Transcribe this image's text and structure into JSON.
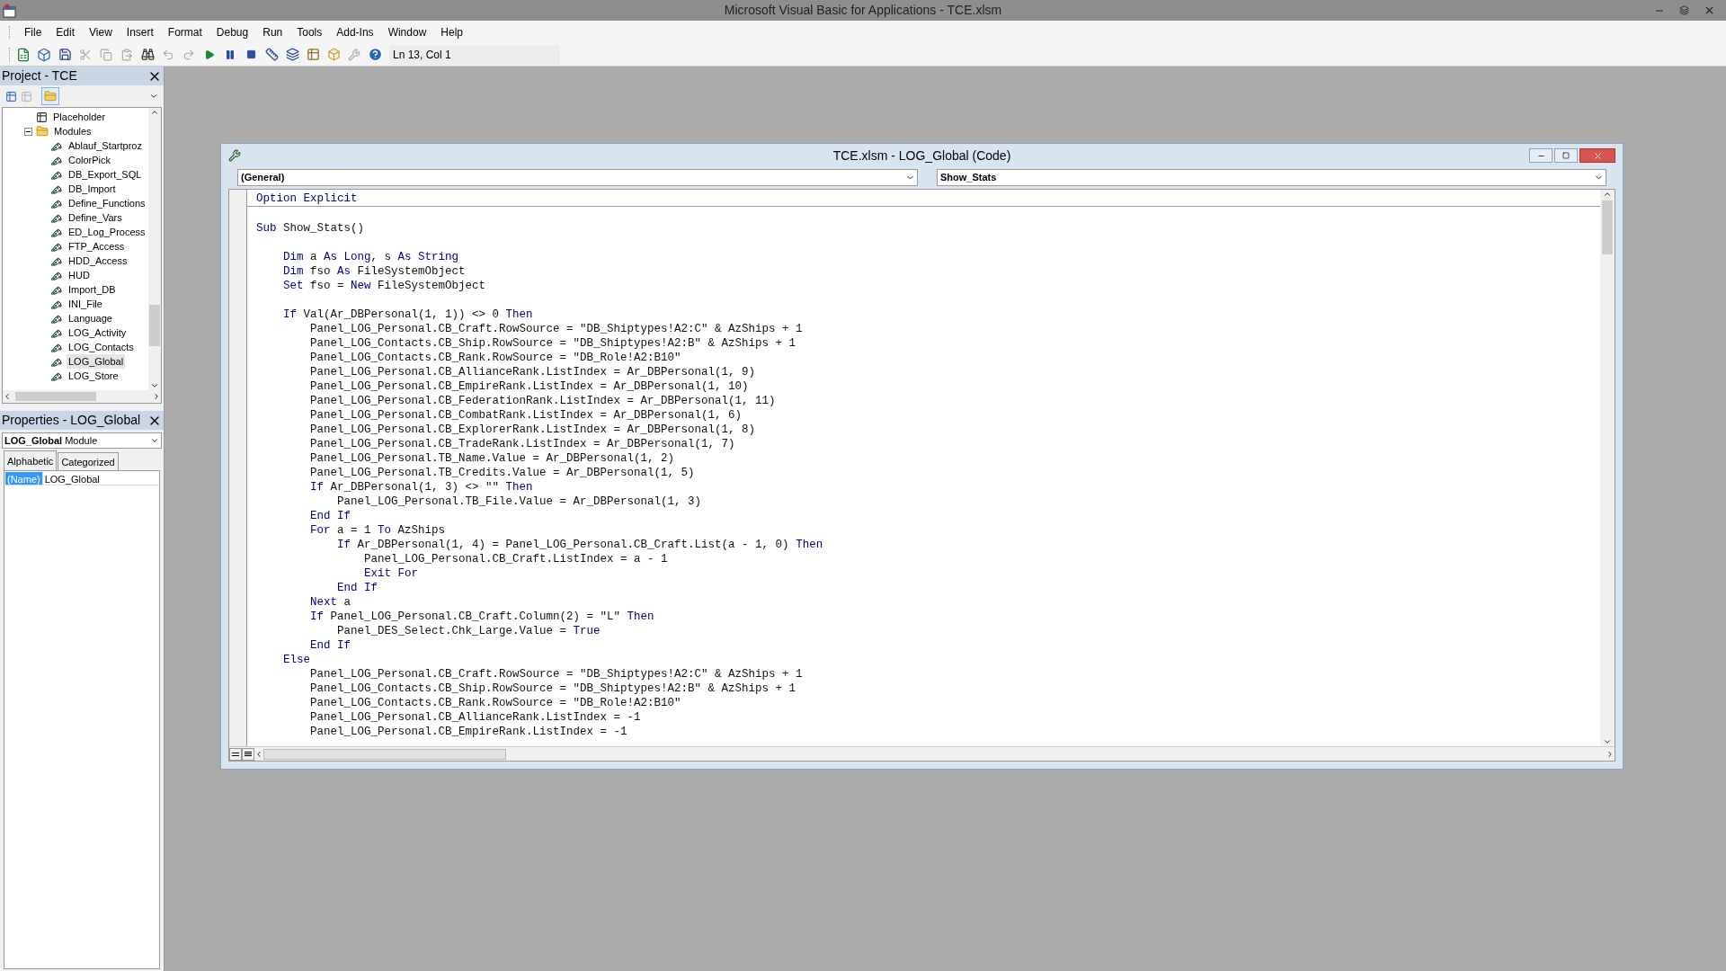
{
  "window": {
    "title": "Microsoft Visual Basic for Applications - TCE.xlsm"
  },
  "menu": [
    "File",
    "Edit",
    "View",
    "Insert",
    "Format",
    "Debug",
    "Run",
    "Tools",
    "Add-Ins",
    "Window",
    "Help"
  ],
  "toolbar": {
    "position": "Ln 13, Col 1"
  },
  "project": {
    "title": "Project - TCE",
    "tree": [
      {
        "label": "Placeholder",
        "kind": "form",
        "selected": false
      },
      {
        "label": "Modules",
        "kind": "folder",
        "expanded": true,
        "selected": false,
        "children": [
          {
            "label": "Ablauf_Startproz",
            "kind": "module",
            "selected": false
          },
          {
            "label": "ColorPick",
            "kind": "module",
            "selected": false
          },
          {
            "label": "DB_Export_SQL",
            "kind": "module",
            "selected": false
          },
          {
            "label": "DB_Import",
            "kind": "module",
            "selected": false
          },
          {
            "label": "Define_Functions",
            "kind": "module",
            "selected": false
          },
          {
            "label": "Define_Vars",
            "kind": "module",
            "selected": false
          },
          {
            "label": "ED_Log_Process",
            "kind": "module",
            "selected": false
          },
          {
            "label": "FTP_Access",
            "kind": "module",
            "selected": false
          },
          {
            "label": "HDD_Access",
            "kind": "module",
            "selected": false
          },
          {
            "label": "HUD",
            "kind": "module",
            "selected": false
          },
          {
            "label": "Import_DB",
            "kind": "module",
            "selected": false
          },
          {
            "label": "INI_File",
            "kind": "module",
            "selected": false
          },
          {
            "label": "Language",
            "kind": "module",
            "selected": false
          },
          {
            "label": "LOG_Activity",
            "kind": "module",
            "selected": false
          },
          {
            "label": "LOG_Contacts",
            "kind": "module",
            "selected": false
          },
          {
            "label": "LOG_Global",
            "kind": "module",
            "selected": true
          },
          {
            "label": "LOG_Store",
            "kind": "module",
            "selected": false
          }
        ]
      }
    ]
  },
  "properties": {
    "title": "Properties - LOG_Global",
    "object_name": "LOG_Global",
    "object_type": "Module",
    "tabs": [
      {
        "label": "Alphabetic",
        "selected": true
      },
      {
        "label": "Categorized",
        "selected": false
      }
    ],
    "rows": [
      {
        "name": "(Name)",
        "value": "LOG_Global",
        "selected": true
      }
    ]
  },
  "code_window": {
    "title": "TCE.xlsm - LOG_Global (Code)",
    "object": "(General)",
    "procedure": "Show_Stats",
    "lines": [
      [
        {
          "kind": "keyword",
          "text": "Option Explicit"
        }
      ],
      [
        {
          "kind": "blank_line"
        },
        {
          "kind": "keyword",
          "text": "Sub "
        },
        {
          "kind": "plain",
          "text": "Show_Stats()"
        }
      ],
      [
        {
          "kind": "blank_line"
        },
        {
          "kind": "keyword",
          "text": "    Dim "
        },
        {
          "kind": "plain",
          "text": "a "
        },
        {
          "kind": "keyword",
          "text": "As Long"
        },
        {
          "kind": "plain",
          "text": ", s "
        },
        {
          "kind": "keyword",
          "text": "As String"
        }
      ],
      [
        {
          "kind": "keyword",
          "text": "    Dim "
        },
        {
          "kind": "plain",
          "text": "fso "
        },
        {
          "kind": "keyword",
          "text": "As "
        },
        {
          "kind": "plain",
          "text": "FileSystemObject"
        }
      ],
      [
        {
          "kind": "keyword",
          "text": "    Set "
        },
        {
          "kind": "plain",
          "text": "fso = "
        },
        {
          "kind": "keyword",
          "text": "New "
        },
        {
          "kind": "plain",
          "text": "FileSystemObject"
        }
      ],
      [
        {
          "kind": "blank_line"
        },
        {
          "kind": "keyword",
          "text": "    If "
        },
        {
          "kind": "plain",
          "text": "Val(Ar_DBPersonal(1, 1)) <> 0 "
        },
        {
          "kind": "keyword",
          "text": "Then"
        }
      ],
      [
        {
          "kind": "plain",
          "text": "        Panel_LOG_Personal.CB_Craft.RowSource = \"DB_Shiptypes!A2:C\" & AzShips + 1"
        }
      ],
      [
        {
          "kind": "plain",
          "text": "        Panel_LOG_Contacts.CB_Ship.RowSource = \"DB_Shiptypes!A2:B\" & AzShips + 1"
        }
      ],
      [
        {
          "kind": "plain",
          "text": "        Panel_LOG_Contacts.CB_Rank.RowSource = \"DB_Role!A2:B10\""
        }
      ],
      [
        {
          "kind": "plain",
          "text": "        Panel_LOG_Personal.CB_AllianceRank.ListIndex = Ar_DBPersonal(1, 9)"
        }
      ],
      [
        {
          "kind": "plain",
          "text": "        Panel_LOG_Personal.CB_EmpireRank.ListIndex = Ar_DBPersonal(1, 10)"
        }
      ],
      [
        {
          "kind": "plain",
          "text": "        Panel_LOG_Personal.CB_FederationRank.ListIndex = Ar_DBPersonal(1, 11)"
        }
      ],
      [
        {
          "kind": "plain",
          "text": "        Panel_LOG_Personal.CB_CombatRank.ListIndex = Ar_DBPersonal(1, 6)"
        }
      ],
      [
        {
          "kind": "plain",
          "text": "        Panel_LOG_Personal.CB_ExplorerRank.ListIndex = Ar_DBPersonal(1, 8)"
        }
      ],
      [
        {
          "kind": "plain",
          "text": "        Panel_LOG_Personal.CB_TradeRank.ListIndex = Ar_DBPersonal(1, 7)"
        }
      ],
      [
        {
          "kind": "plain",
          "text": "        Panel_LOG_Personal.TB_Name.Value = Ar_DBPersonal(1, 2)"
        }
      ],
      [
        {
          "kind": "plain",
          "text": "        Panel_LOG_Personal.TB_Credits.Value = Ar_DBPersonal(1, 5)"
        }
      ],
      [
        {
          "kind": "keyword",
          "text": "        If "
        },
        {
          "kind": "plain",
          "text": "Ar_DBPersonal(1, 3) <> \"\" "
        },
        {
          "kind": "keyword",
          "text": "Then"
        }
      ],
      [
        {
          "kind": "plain",
          "text": "            Panel_LOG_Personal.TB_File.Value = Ar_DBPersonal(1, 3)"
        }
      ],
      [
        {
          "kind": "keyword",
          "text": "        End If"
        }
      ],
      [
        {
          "kind": "keyword",
          "text": "        For "
        },
        {
          "kind": "plain",
          "text": "a = 1 "
        },
        {
          "kind": "keyword",
          "text": "To "
        },
        {
          "kind": "plain",
          "text": "AzShips"
        }
      ],
      [
        {
          "kind": "keyword",
          "text": "            If "
        },
        {
          "kind": "plain",
          "text": "Ar_DBPersonal(1, 4) = Panel_LOG_Personal.CB_Craft.List(a - 1, 0) "
        },
        {
          "kind": "keyword",
          "text": "Then"
        }
      ],
      [
        {
          "kind": "plain",
          "text": "                Panel_LOG_Personal.CB_Craft.ListIndex = a - 1"
        }
      ],
      [
        {
          "kind": "keyword",
          "text": "                Exit For"
        }
      ],
      [
        {
          "kind": "keyword",
          "text": "            End If"
        }
      ],
      [
        {
          "kind": "keyword",
          "text": "        Next "
        },
        {
          "kind": "plain",
          "text": "a"
        }
      ],
      [
        {
          "kind": "keyword",
          "text": "        If "
        },
        {
          "kind": "plain",
          "text": "Panel_LOG_Personal.CB_Craft.Column(2) = \"L\" "
        },
        {
          "kind": "keyword",
          "text": "Then"
        }
      ],
      [
        {
          "kind": "plain",
          "text": "            Panel_DES_Select.Chk_Large.Value = "
        },
        {
          "kind": "keyword",
          "text": "True"
        }
      ],
      [
        {
          "kind": "keyword",
          "text": "        End If"
        }
      ],
      [
        {
          "kind": "keyword",
          "text": "    Else"
        }
      ],
      [
        {
          "kind": "plain",
          "text": "        Panel_LOG_Personal.CB_Craft.RowSource = \"DB_Shiptypes!A2:C\" & AzShips + 1"
        }
      ],
      [
        {
          "kind": "plain",
          "text": "        Panel_LOG_Contacts.CB_Ship.RowSource = \"DB_Shiptypes!A2:B\" & AzShips + 1"
        }
      ],
      [
        {
          "kind": "plain",
          "text": "        Panel_LOG_Contacts.CB_Rank.RowSource = \"DB_Role!A2:B10\""
        }
      ],
      [
        {
          "kind": "plain",
          "text": "        Panel_LOG_Personal.CB_AllianceRank.ListIndex = -1"
        }
      ],
      [
        {
          "kind": "plain",
          "text": "        Panel_LOG_Personal.CB_EmpireRank.ListIndex = -1"
        }
      ]
    ]
  }
}
